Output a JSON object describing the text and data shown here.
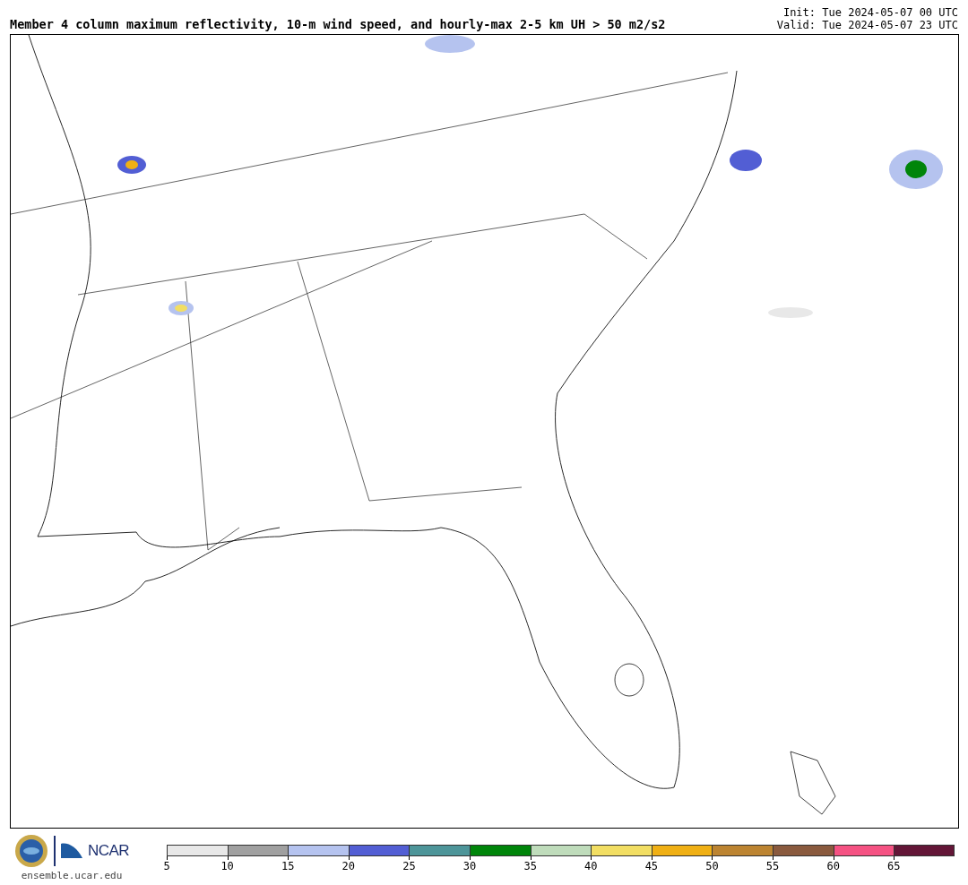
{
  "header": {
    "title": "Member 4 column maximum reflectivity, 10-m wind speed, and hourly-max 2-5 km UH > 50 m2/s2",
    "init": "Init: Tue 2024-05-07 00 UTC",
    "valid": "Valid: Tue 2024-05-07 23 UTC"
  },
  "footer": {
    "logo_text": "NCAR",
    "url": "ensemble.ucar.edu"
  },
  "colorbar": {
    "bins": [
      {
        "color": "#e8e8e8",
        "label": "5"
      },
      {
        "color": "#a0a0a0",
        "label": "10"
      },
      {
        "color": "#b5c3ef",
        "label": "15"
      },
      {
        "color": "#525ed4",
        "label": "20"
      },
      {
        "color": "#4d9599",
        "label": "25"
      },
      {
        "color": "#00850a",
        "label": "30"
      },
      {
        "color": "#bfdcbb",
        "label": "35"
      },
      {
        "color": "#f2de63",
        "label": "40"
      },
      {
        "color": "#f0b015",
        "label": "45"
      },
      {
        "color": "#bc8431",
        "label": "50"
      },
      {
        "color": "#8a5a3e",
        "label": "55"
      },
      {
        "color": "#f55283",
        "label": "60"
      },
      {
        "color": "#631637",
        "label": "65"
      }
    ]
  }
}
